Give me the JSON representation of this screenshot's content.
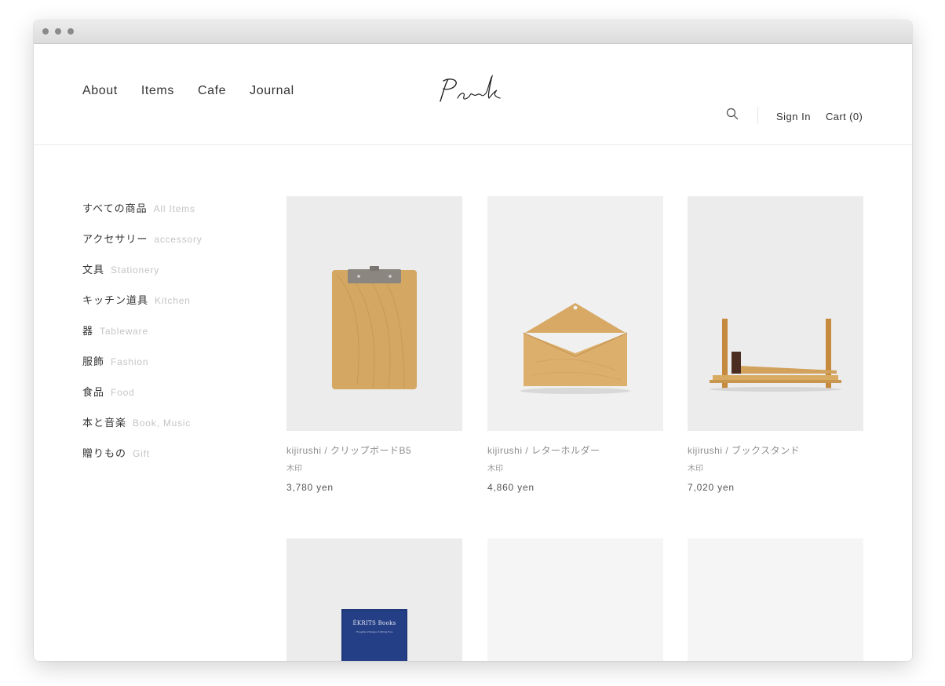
{
  "nav": {
    "items": [
      "About",
      "Items",
      "Cafe",
      "Journal"
    ]
  },
  "logo": {
    "text": "Park"
  },
  "header": {
    "sign_in": "Sign In",
    "cart": "Cart (0)"
  },
  "sidebar": {
    "categories": [
      {
        "jp": "すべての商品",
        "en": "All Items"
      },
      {
        "jp": "アクセサリー",
        "en": "accessory"
      },
      {
        "jp": "文具",
        "en": "Stationery"
      },
      {
        "jp": "キッチン道具",
        "en": "Kitchen"
      },
      {
        "jp": "器",
        "en": "Tableware"
      },
      {
        "jp": "服飾",
        "en": "Fashion"
      },
      {
        "jp": "食品",
        "en": "Food"
      },
      {
        "jp": "本と音楽",
        "en": "Book, Music"
      },
      {
        "jp": "贈りもの",
        "en": "Gift"
      }
    ]
  },
  "products": [
    {
      "title": "kijirushi / クリップボードB5",
      "brand": "木印",
      "price": "3,780 yen"
    },
    {
      "title": "kijirushi / レターホルダー",
      "brand": "木印",
      "price": "4,860 yen"
    },
    {
      "title": "kijirushi / ブックスタンド",
      "brand": "木印",
      "price": "7,020 yen"
    }
  ],
  "book": {
    "title": "ÉKRITS Books",
    "subtitle": "Thoughts of Design of Writing Time"
  },
  "icons": {
    "search": "search-icon"
  },
  "colors": {
    "accent": "#333333",
    "muted": "#c4c4c4",
    "wood": "#d2a35c"
  }
}
